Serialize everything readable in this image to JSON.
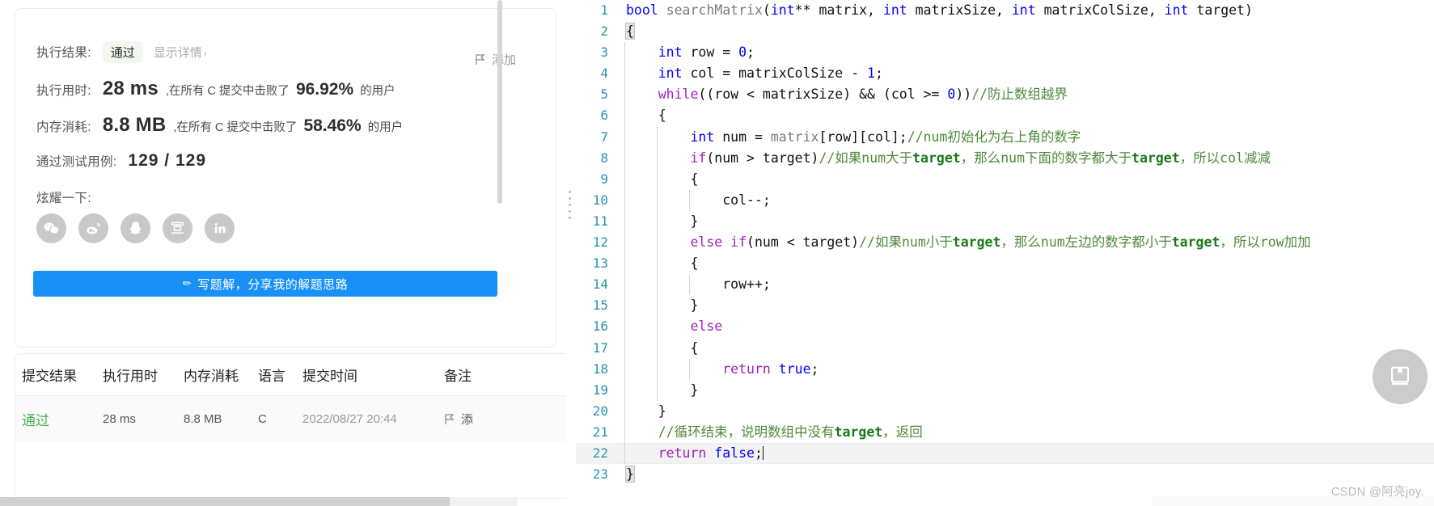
{
  "left_panel": {
    "result_card": {
      "exec_result_label": "执行结果:",
      "status_badge": "通过",
      "detail_link": "显示详情",
      "detail_chevron": "›",
      "exec_time_label": "执行用时:",
      "exec_time_value": "28 ms",
      "exec_time_mid": ",在所有 C 提交中击败了",
      "exec_time_pct": "96.92%",
      "exec_time_tail": "的用户",
      "memory_label": "内存消耗:",
      "memory_value": "8.8 MB",
      "memory_mid": ",在所有 C 提交中击败了",
      "memory_pct": "58.46%",
      "memory_tail": "的用户",
      "testcase_label": "通过测试用例:",
      "testcase_value": "129 / 129",
      "show_off_label": "炫耀一下:",
      "add_note_label": "添加",
      "add_note_icon": "flag-icon",
      "socials": [
        {
          "name": "wechat-icon",
          "label": "微信"
        },
        {
          "name": "weibo-icon",
          "label": "微博"
        },
        {
          "name": "qq-icon",
          "label": "QQ"
        },
        {
          "name": "douban-icon",
          "label": "豆瓣"
        },
        {
          "name": "linkedin-icon",
          "label": "LinkedIn"
        }
      ],
      "write_button": {
        "icon": "pencil-icon",
        "label": "写题解，分享我的解题思路"
      }
    },
    "submissions_table": {
      "headers": [
        "提交结果",
        "执行用时",
        "内存消耗",
        "语言",
        "提交时间",
        "备注"
      ],
      "rows": [
        {
          "result": "通过",
          "runtime": "28 ms",
          "memory": "8.8 MB",
          "language": "C",
          "submitted_at": "2022/08/27 20:44",
          "note_icon": "flag-icon",
          "note": "添"
        }
      ]
    }
  },
  "code_panel": {
    "bookmark_icon": "book-bookmark-icon",
    "watermark": "CSDN @阿亮joy.",
    "lines": [
      {
        "n": "1",
        "segs": [
          {
            "t": "bool ",
            "c": "kw"
          },
          {
            "t": "searchMatrix",
            "c": "fn"
          },
          {
            "t": "(",
            "c": "pl"
          },
          {
            "t": "int",
            "c": "kw"
          },
          {
            "t": "** matrix, ",
            "c": "pl"
          },
          {
            "t": "int",
            "c": "kw"
          },
          {
            "t": " matrixSize, ",
            "c": "pl"
          },
          {
            "t": "int",
            "c": "kw"
          },
          {
            "t": " matrixColSize, ",
            "c": "pl"
          },
          {
            "t": "int",
            "c": "kw"
          },
          {
            "t": " target)",
            "c": "pl"
          }
        ]
      },
      {
        "n": "2",
        "segs": [
          {
            "t": "{",
            "c": "pl hl-brace"
          }
        ]
      },
      {
        "n": "3",
        "segs": [
          {
            "t": "    ",
            "c": "pl"
          },
          {
            "t": "int",
            "c": "kw"
          },
          {
            "t": " row = ",
            "c": "pl"
          },
          {
            "t": "0",
            "c": "num"
          },
          {
            "t": ";",
            "c": "pl"
          }
        ]
      },
      {
        "n": "4",
        "segs": [
          {
            "t": "    ",
            "c": "pl"
          },
          {
            "t": "int",
            "c": "kw"
          },
          {
            "t": " col = matrixColSize - ",
            "c": "pl"
          },
          {
            "t": "1",
            "c": "num"
          },
          {
            "t": ";",
            "c": "pl"
          }
        ]
      },
      {
        "n": "5",
        "segs": [
          {
            "t": "    ",
            "c": "pl"
          },
          {
            "t": "while",
            "c": "kw2"
          },
          {
            "t": "((row < matrixSize) && (col >= ",
            "c": "pl"
          },
          {
            "t": "0",
            "c": "num"
          },
          {
            "t": "))",
            "c": "pl"
          },
          {
            "t": "//防止数组越界",
            "c": "cm"
          }
        ]
      },
      {
        "n": "6",
        "segs": [
          {
            "t": "    {",
            "c": "pl"
          }
        ]
      },
      {
        "n": "7",
        "segs": [
          {
            "t": "        ",
            "c": "pl"
          },
          {
            "t": "int",
            "c": "kw"
          },
          {
            "t": " num = ",
            "c": "pl"
          },
          {
            "t": "matrix",
            "c": "fn"
          },
          {
            "t": "[row][col];",
            "c": "pl"
          },
          {
            "t": "//num初始化为右上角的数字",
            "c": "cm"
          }
        ]
      },
      {
        "n": "8",
        "segs": [
          {
            "t": "        ",
            "c": "pl"
          },
          {
            "t": "if",
            "c": "kw2"
          },
          {
            "t": "(num > target)",
            "c": "pl"
          },
          {
            "t": "//如果num大于",
            "c": "cm"
          },
          {
            "t": "target",
            "c": "cmb"
          },
          {
            "t": "，那么num下面的数字都大于",
            "c": "cm"
          },
          {
            "t": "target",
            "c": "cmb"
          },
          {
            "t": "，所以col减减",
            "c": "cm"
          }
        ]
      },
      {
        "n": "9",
        "segs": [
          {
            "t": "        {",
            "c": "pl"
          }
        ]
      },
      {
        "n": "10",
        "segs": [
          {
            "t": "            col--;",
            "c": "pl"
          }
        ]
      },
      {
        "n": "11",
        "segs": [
          {
            "t": "        }",
            "c": "pl"
          }
        ]
      },
      {
        "n": "12",
        "segs": [
          {
            "t": "        ",
            "c": "pl"
          },
          {
            "t": "else if",
            "c": "kw2"
          },
          {
            "t": "(num < target)",
            "c": "pl"
          },
          {
            "t": "//如果num小于",
            "c": "cm"
          },
          {
            "t": "target",
            "c": "cmb"
          },
          {
            "t": "，那么num左边的数字都小于",
            "c": "cm"
          },
          {
            "t": "target",
            "c": "cmb"
          },
          {
            "t": "，所以row加加",
            "c": "cm"
          }
        ]
      },
      {
        "n": "13",
        "segs": [
          {
            "t": "        {",
            "c": "pl"
          }
        ]
      },
      {
        "n": "14",
        "segs": [
          {
            "t": "            row++;",
            "c": "pl"
          }
        ]
      },
      {
        "n": "15",
        "segs": [
          {
            "t": "        }",
            "c": "pl"
          }
        ]
      },
      {
        "n": "16",
        "segs": [
          {
            "t": "        ",
            "c": "pl"
          },
          {
            "t": "else",
            "c": "kw2"
          }
        ]
      },
      {
        "n": "17",
        "segs": [
          {
            "t": "        {",
            "c": "pl"
          }
        ]
      },
      {
        "n": "18",
        "segs": [
          {
            "t": "            ",
            "c": "pl"
          },
          {
            "t": "return",
            "c": "kw2"
          },
          {
            "t": " ",
            "c": "pl"
          },
          {
            "t": "true",
            "c": "kw"
          },
          {
            "t": ";",
            "c": "pl"
          }
        ]
      },
      {
        "n": "19",
        "segs": [
          {
            "t": "        }",
            "c": "pl"
          }
        ]
      },
      {
        "n": "20",
        "segs": [
          {
            "t": "    }",
            "c": "pl"
          }
        ]
      },
      {
        "n": "21",
        "segs": [
          {
            "t": "    ",
            "c": "pl"
          },
          {
            "t": "//循环结束，说明数组中没有",
            "c": "cm"
          },
          {
            "t": "target",
            "c": "cmb"
          },
          {
            "t": "，返回",
            "c": "cm"
          }
        ]
      },
      {
        "n": "22",
        "segs": [
          {
            "t": "    ",
            "c": "pl"
          },
          {
            "t": "return",
            "c": "kw2"
          },
          {
            "t": " ",
            "c": "pl"
          },
          {
            "t": "false",
            "c": "kw"
          },
          {
            "t": ";",
            "c": "pl"
          }
        ],
        "caret": true,
        "current": true
      },
      {
        "n": "23",
        "segs": [
          {
            "t": "}",
            "c": "pl hl-brace"
          }
        ]
      }
    ]
  }
}
